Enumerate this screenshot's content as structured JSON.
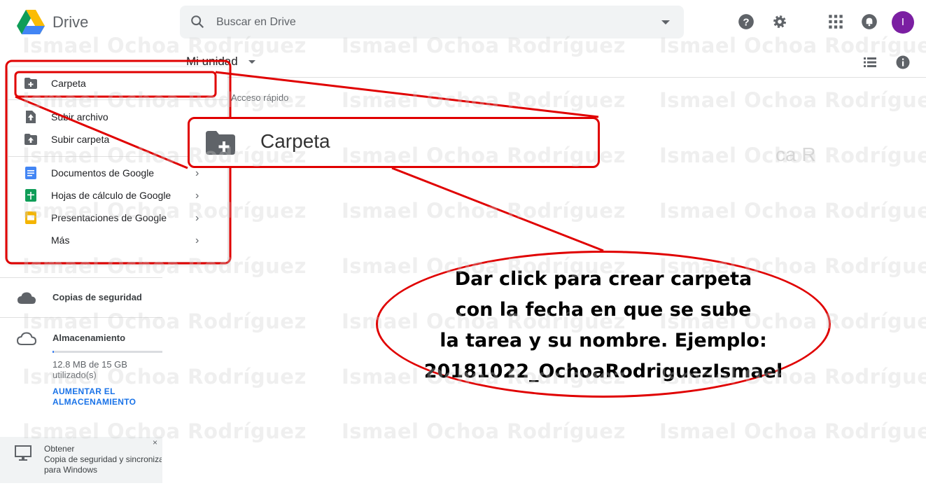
{
  "header": {
    "app_name": "Drive",
    "search_placeholder": "Buscar en Drive",
    "avatar_letter": "I"
  },
  "subheader": {
    "breadcrumb": "Mi unidad",
    "quick_access_label": "Acceso rápido"
  },
  "new_menu": {
    "items": [
      {
        "label": "Carpeta",
        "icon": "folder-plus-icon"
      },
      {
        "label": "Subir archivo",
        "icon": "file-upload-icon"
      },
      {
        "label": "Subir carpeta",
        "icon": "folder-upload-icon"
      },
      {
        "label": "Documentos de Google",
        "icon": "google-docs-icon"
      },
      {
        "label": "Hojas de cálculo de Google",
        "icon": "google-sheets-icon"
      },
      {
        "label": "Presentaciones de Google",
        "icon": "google-slides-icon"
      },
      {
        "label": "Más",
        "icon": ""
      }
    ]
  },
  "sidebar": {
    "backups_label": "Copias de seguridad",
    "storage_label": "Almacenamiento",
    "storage_used": "12.8 MB de 15 GB utilizado(s)",
    "storage_fraction": 0.001,
    "upgrade_label": "AUMENTAR EL ALMACENAMIENTO",
    "promo": {
      "line1": "Obtener",
      "line2": "Copia de seguridad y sincronización",
      "line3": "para Windows",
      "close": "×"
    }
  },
  "annotation": {
    "callout_label": "Carpeta",
    "bubble_lines": [
      "Dar click para crear carpeta",
      "con la fecha en que se sube",
      "la tarea y su nombre. Ejemplo:",
      "20181022_OchoaRodriguezIsmael"
    ],
    "watermark": "Ismael Ochoa Rodríguez",
    "partial_text": "ca R",
    "accent_color": "#e00000"
  }
}
